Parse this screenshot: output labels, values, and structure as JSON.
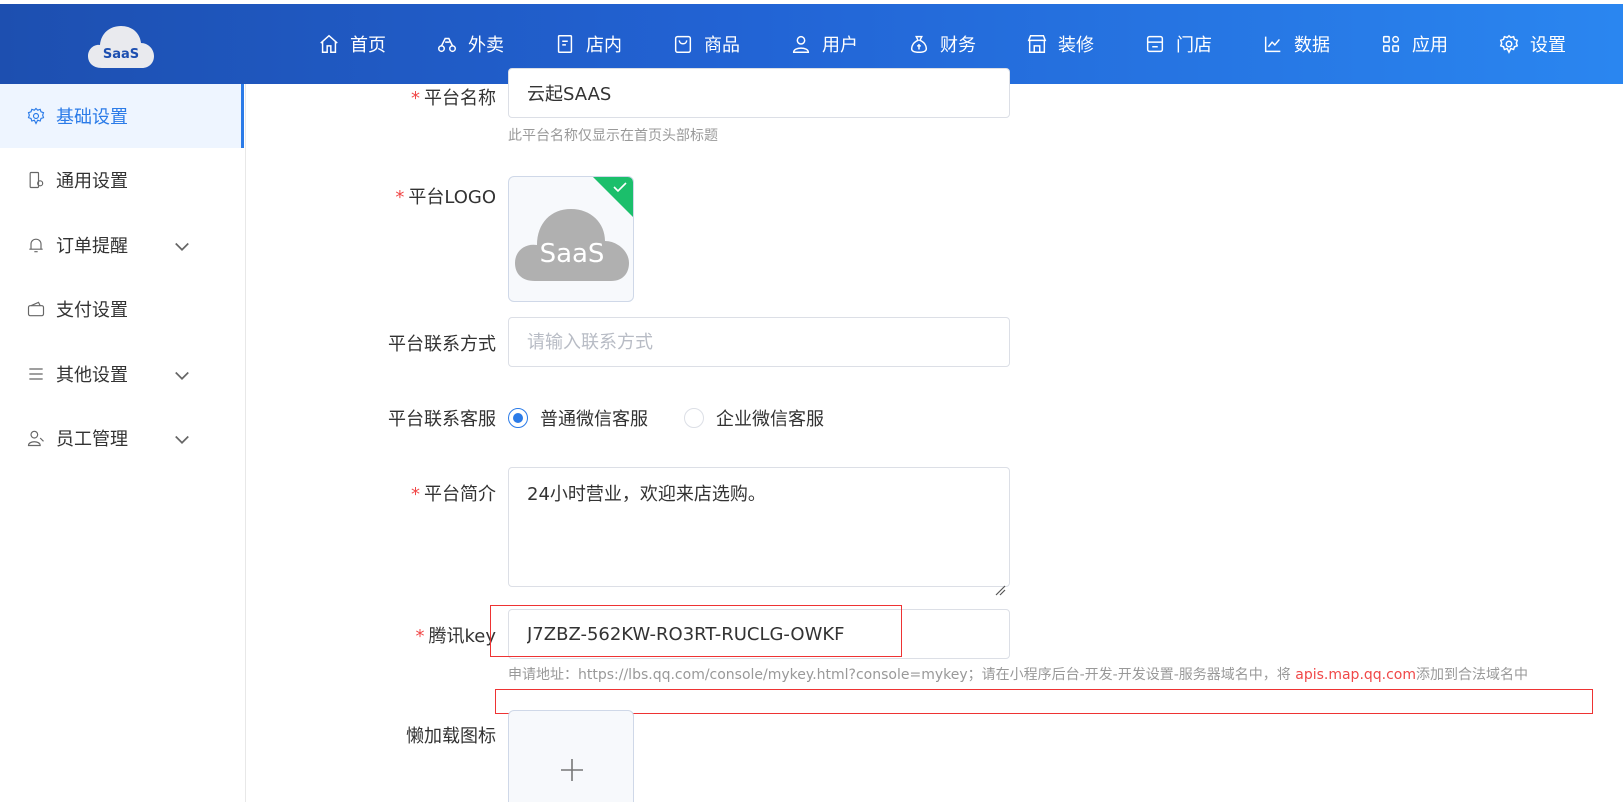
{
  "brand": {
    "logo_text": "SaaS"
  },
  "nav": [
    {
      "label": "首页",
      "icon": "home-icon"
    },
    {
      "label": "外卖",
      "icon": "scooter-icon"
    },
    {
      "label": "店内",
      "icon": "store-tag-icon"
    },
    {
      "label": "商品",
      "icon": "bag-icon"
    },
    {
      "label": "用户",
      "icon": "user-icon"
    },
    {
      "label": "财务",
      "icon": "money-bag-icon"
    },
    {
      "label": "装修",
      "icon": "storefront-icon"
    },
    {
      "label": "门店",
      "icon": "shop-icon"
    },
    {
      "label": "数据",
      "icon": "chart-line-icon"
    },
    {
      "label": "应用",
      "icon": "apps-icon"
    },
    {
      "label": "设置",
      "icon": "gear-icon"
    }
  ],
  "sidebar": {
    "items": [
      {
        "label": "基础设置",
        "icon": "gear-icon",
        "active": true
      },
      {
        "label": "通用设置",
        "icon": "phone-gear-icon"
      },
      {
        "label": "订单提醒",
        "icon": "bell-icon",
        "expandable": true
      },
      {
        "label": "支付设置",
        "icon": "wallet-icon"
      },
      {
        "label": "其他设置",
        "icon": "list-icon",
        "expandable": true
      },
      {
        "label": "员工管理",
        "icon": "staff-icon",
        "expandable": true
      }
    ]
  },
  "form": {
    "platform_name": {
      "label": "平台名称",
      "value": "云起SAAS",
      "hint": "此平台名称仅显示在首页头部标题"
    },
    "platform_logo": {
      "label": "平台LOGO",
      "image_text": "SaaS"
    },
    "contact": {
      "label": "平台联系方式",
      "placeholder": "请输入联系方式"
    },
    "customer_service": {
      "label": "平台联系客服",
      "options": [
        "普通微信客服",
        "企业微信客服"
      ],
      "selected": "普通微信客服"
    },
    "intro": {
      "label": "平台简介",
      "value": "24小时营业，欢迎来店选购。"
    },
    "tencent_key": {
      "label": "腾讯key",
      "value": "J7ZBZ-562KW-RO3RT-RUCLG-OWKF",
      "hint_prefix": "申请地址：https://lbs.qq.com/console/mykey.html?console=mykey；请在小程序后台-开发-开发设置-服务器域名中，将 ",
      "hint_domain": "apis.map.qq.com",
      "hint_suffix": "添加到合法域名中"
    },
    "lazy_icon": {
      "label": "懒加载图标"
    }
  },
  "colors": {
    "accent": "#2b7be8",
    "required": "#f04848",
    "success": "#1bbf6b"
  }
}
